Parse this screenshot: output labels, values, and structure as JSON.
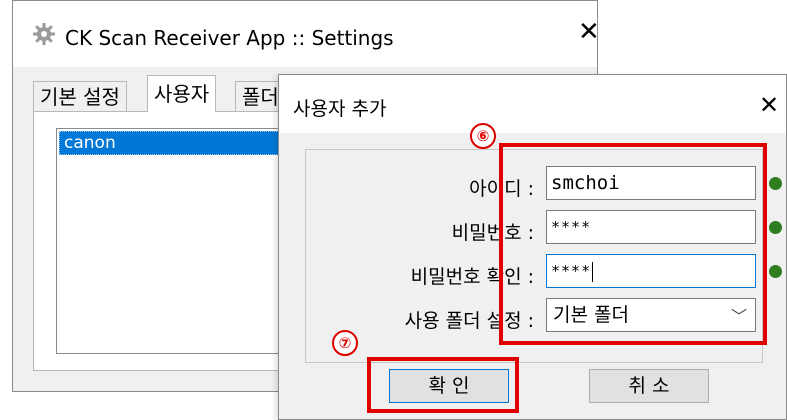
{
  "settings_window": {
    "title": "CK Scan Receiver App :: Settings",
    "close_glyph": "✕",
    "tabs": [
      {
        "label": "기본 설정"
      },
      {
        "label": "사용자"
      },
      {
        "label": "폴더"
      }
    ],
    "users": [
      "canon"
    ]
  },
  "dialog": {
    "title": "사용자 추가",
    "close_glyph": "✕",
    "fields": {
      "id_label": "아이디 :",
      "id_value": "smchoi",
      "password_label": "비밀번호 :",
      "password_value": "****",
      "confirm_label": "비밀번호 확인 :",
      "confirm_value": "****",
      "folder_label": "사용 폴더 설정 :",
      "folder_value": "기본 폴더"
    },
    "ok_label": "확 인",
    "cancel_label": "취 소"
  },
  "annotations": {
    "marker_6": "⑥",
    "marker_7": "⑦",
    "color": "#e00000"
  },
  "icons": {
    "app": "gear-icon",
    "close": "close-icon",
    "dropdown": "chevron-down-icon",
    "status": "status-dot"
  },
  "colors": {
    "status_ok": "#2e7d1f",
    "selection": "#0078d7"
  }
}
